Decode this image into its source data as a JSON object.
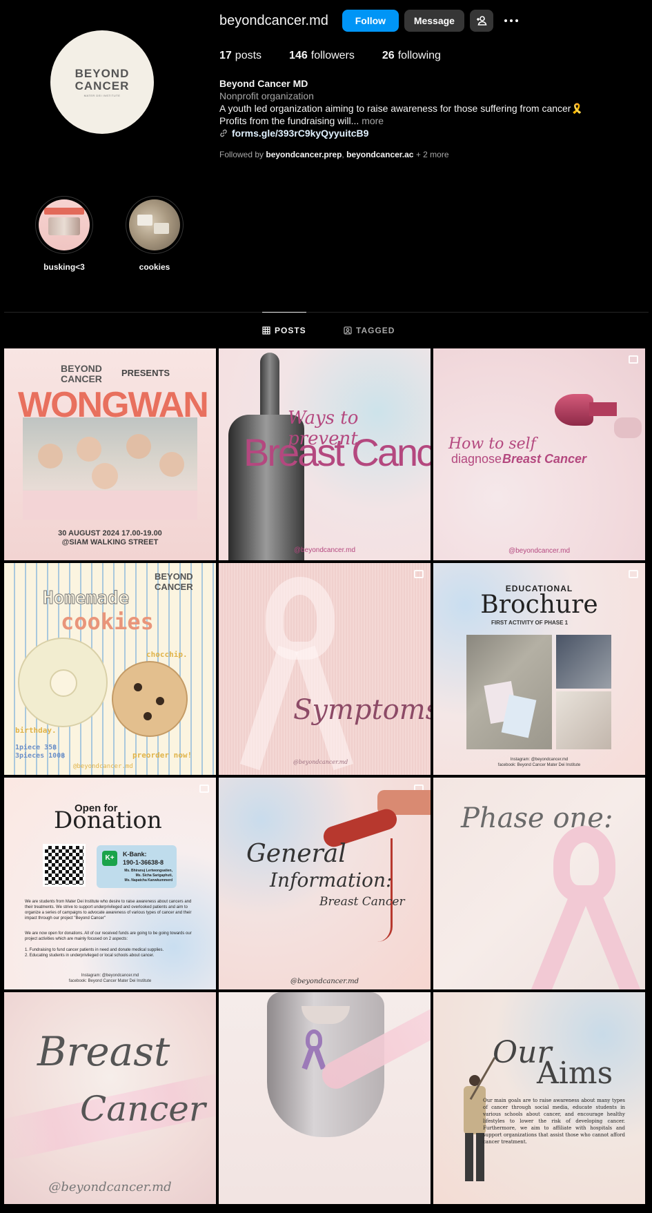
{
  "profile": {
    "username": "beyondcancer.md",
    "follow_label": "Follow",
    "message_label": "Message",
    "avatar_logo_top": "BEYOND",
    "avatar_logo_bottom": "CANCER",
    "avatar_logo_sub": "MATER DEI INSTITUTE",
    "stats": {
      "posts_count": "17",
      "posts_label": "posts",
      "followers_count": "146",
      "followers_label": "followers",
      "following_count": "26",
      "following_label": "following"
    },
    "full_name": "Beyond Cancer MD",
    "category": "Nonprofit organization",
    "bio_line1": "A youth led organization aiming to raise awareness for those suffering from cancer🎗️",
    "bio_line2": "Profits from the fundraising will...",
    "more_label": "more",
    "link": "forms.gle/393rC9kyQyyuitcB9",
    "followed_by_prefix": "Followed by",
    "followed_by_user1": "beyondcancer.prep",
    "followed_by_user2": "beyondcancer.ac",
    "followed_by_more": "+ 2 more"
  },
  "highlights": [
    {
      "label": "busking<3"
    },
    {
      "label": "cookies"
    }
  ],
  "tabs": {
    "posts": "POSTS",
    "tagged": "TAGGED"
  },
  "posts": {
    "p1": {
      "brand": "BEYOND CANCER",
      "presents": "PRESENTS",
      "title": "WONGWAN",
      "date": "30 AUGUST 2024 17.00-19.00",
      "place": "@SIAM WALKING STREET"
    },
    "p2": {
      "title1": "Ways to prevent",
      "title2": "Breast Cancer",
      "handle": "@beyondcancer.md"
    },
    "p3": {
      "title1": "How to self",
      "title2": "diagnose",
      "title3": "Breast Cancer",
      "handle": "@beyondcancer.md"
    },
    "p4": {
      "title1": "Homemade",
      "title2": "cookies",
      "tag1": "chocchip.",
      "tag2": "birthday.",
      "price1": "1piece 35฿",
      "price2": "3pieces 100฿",
      "preorder": "preorder now!",
      "handle": "@beyondcancer.md"
    },
    "p5": {
      "title": "Symptoms",
      "handle": "@beyondcancer.md"
    },
    "p6": {
      "title1": "EDUCATIONAL",
      "title2": "Brochure",
      "subtitle": "FIRST ACTIVITY OF PHASE 1",
      "footer1": "Instagram: @beyondcancer.md",
      "footer2": "facebook: Beyond Cancer Mater Dei Institute"
    },
    "p7": {
      "title1": "Open for",
      "title2": "Donation",
      "bank": "K-Bank:",
      "account": "190-1-36638-8",
      "names": [
        "Ms. Bhiranuj Lertwongsatien,",
        "Ms. Sicha Sarigaphuti,",
        "Ms. Napatcha Kanwkummerd"
      ],
      "para1": "We are students from Mater Dei Institute who desire to raise awareness about cancers and their treatments. We strive to support underprivileged and overlooked patients and aim to organize a series of campaigns to advocate awareness of various types of cancer and their impact through our project \"Beyond Cancer\"",
      "para2": "We are now open for donations. All of our received funds are going to be going towards our project activities which are mainly focused on 2 aspects:",
      "item1": "1. Fundraising to fund cancer patients in need and donate medical supplies.",
      "item2": "2. Educating students in underprivileged or local schools about cancer.",
      "footer1": "Instagram: @beyondcancer.md",
      "footer2": "facebook: Beyond Cancer Mater Dei Institute"
    },
    "p8": {
      "title1": "General",
      "title2": "Information:",
      "title3": "Breast Cancer",
      "handle": "@beyondcancer.md"
    },
    "p9": {
      "title": "Phase one:"
    },
    "p10": {
      "title1": "Breast",
      "title2": "Cancer",
      "handle": "@beyondcancer.md"
    },
    "p12": {
      "title1": "Our",
      "title2": "Aims",
      "body": "Our main goals are to raise awareness about many types of cancer through social media, educate students in various schools about cancer, and encourage healthy lifestyles to lower the risk of developing cancer. Furthermore, we aim to affiliate with hospitals and support organizations that assist those who cannot afford cancer treatment."
    }
  },
  "colors": {
    "follow_blue": "#0095f6",
    "button_dark": "#363636",
    "accent_pink": "#b4487f"
  }
}
